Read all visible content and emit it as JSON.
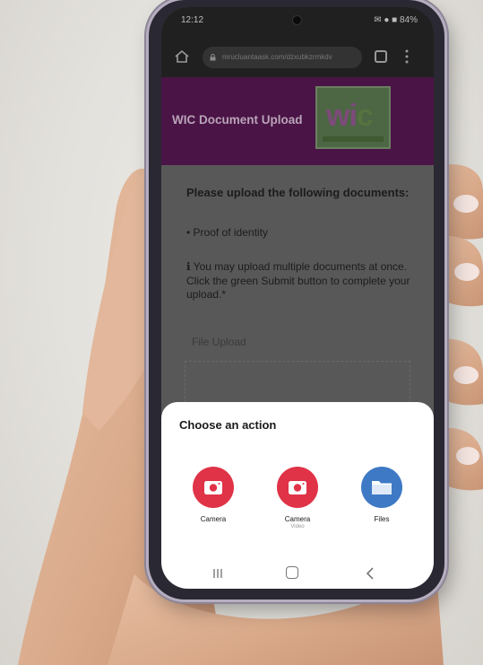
{
  "statusbar": {
    "time": "12:12",
    "time_suffix": "•• ✕",
    "right": "✉ ● ■ 84%"
  },
  "browser": {
    "url": "mrucluantaask.com/dzxubkzrmkdv"
  },
  "header": {
    "title": "WIC Document Upload",
    "logo_text_w": "wi",
    "logo_text_c": "c"
  },
  "instructions": {
    "title": "Please upload the following documents:",
    "bullet": "• Proof of identity",
    "note": "ℹ You may upload multiple documents at once. Click the green Submit button to complete your upload.*"
  },
  "upload": {
    "label": "File Upload"
  },
  "sheet": {
    "title": "Choose an action",
    "actions": [
      {
        "label": "Camera",
        "sub": ""
      },
      {
        "label": "Camera",
        "sub": "Video"
      },
      {
        "label": "Files",
        "sub": ""
      }
    ]
  },
  "colors": {
    "header_purple": "#4a1446",
    "camera_red": "#e03347",
    "files_blue": "#3e79c5",
    "sheet_bg": "#ffffff"
  },
  "icons": [
    "home-icon",
    "lock-icon",
    "tabs-icon",
    "menu-icon",
    "camera-icon",
    "video-camera-icon",
    "folder-icon",
    "recent-apps-icon",
    "home-button-icon",
    "back-icon"
  ]
}
